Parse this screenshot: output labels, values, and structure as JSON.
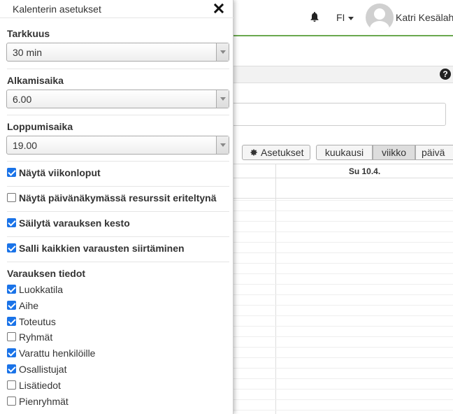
{
  "header": {
    "language": "FI",
    "user_name": "Katri Kesälaht",
    "bell_icon": "bell-icon",
    "help_icon": "?"
  },
  "toolbar": {
    "settings_label": "Asetukset",
    "month_label": "kuukausi",
    "week_label": "viikko",
    "day_label": "päivä"
  },
  "calendar": {
    "day_header": "Su 10.4."
  },
  "panel": {
    "title": "Kalenterin asetukset",
    "precision": {
      "label": "Tarkkuus",
      "value": "30 min"
    },
    "start_time": {
      "label": "Alkamisaika",
      "value": "6.00"
    },
    "end_time": {
      "label": "Loppumisaika",
      "value": "19.00"
    },
    "options": [
      {
        "label": "Näytä viikonloput",
        "checked": true
      },
      {
        "label": "Näytä päivänäkymässä resurssit eriteltynä",
        "checked": false
      },
      {
        "label": "Säilytä varauksen kesto",
        "checked": true
      },
      {
        "label": "Salli kaikkien varausten siirtäminen",
        "checked": true
      }
    ],
    "details": {
      "label": "Varauksen tiedot",
      "items": [
        {
          "label": "Luokkatila",
          "checked": true
        },
        {
          "label": "Aihe",
          "checked": true
        },
        {
          "label": "Toteutus",
          "checked": true
        },
        {
          "label": "Ryhmät",
          "checked": false
        },
        {
          "label": "Varattu henkilöille",
          "checked": true
        },
        {
          "label": "Osallistujat",
          "checked": true
        },
        {
          "label": "Lisätiedot",
          "checked": false
        },
        {
          "label": "Pienryhmät",
          "checked": false
        }
      ]
    }
  },
  "colors": {
    "accent_green": "#6aa84f",
    "checkbox_blue": "#1a73e8"
  }
}
